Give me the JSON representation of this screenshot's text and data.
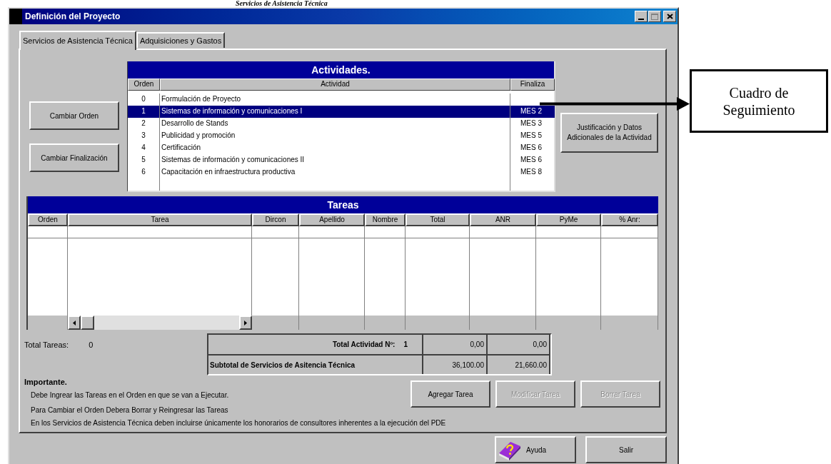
{
  "document_caption": "Servicios de Asistencia Técnica",
  "window": {
    "title": "Definición del Proyecto"
  },
  "tabs": [
    {
      "label": "Servicios de Asistencia Técnica",
      "selected": true
    },
    {
      "label": "Adquisiciones y Gastos",
      "selected": false
    }
  ],
  "side_buttons": [
    "Cambiar Orden",
    "Cambiar Finalización"
  ],
  "activities": {
    "title": "Actividades.",
    "columns": [
      "Orden",
      "Actividad",
      "Finaliza"
    ],
    "rows": [
      {
        "orden": "0",
        "actividad": "Formulación de Proyecto",
        "selected": false
      },
      {
        "orden": "1",
        "actividad": "Sistemas de información y comunicaciones I",
        "finaliza": "MES 2",
        "selected": true
      },
      {
        "orden": "2",
        "actividad": "Desarrollo de Stands",
        "finaliza": "MES 3",
        "selected": false
      },
      {
        "orden": "3",
        "actividad": "Publicidad y promoción",
        "finaliza": "MES 5",
        "selected": false
      },
      {
        "orden": "4",
        "actividad": "Certificación",
        "finaliza": "MES 6",
        "selected": false
      },
      {
        "orden": "5",
        "actividad": "Sistemas de información y comunicaciones II",
        "finaliza": "MES 6",
        "selected": false
      },
      {
        "orden": "6",
        "actividad": "Capacitación en infraestructura productiva",
        "finaliza": "MES 8",
        "selected": false
      }
    ]
  },
  "detail_button": "Justificación y Datos Adicionales de la Actividad",
  "tasks": {
    "title": "Tareas",
    "columns": [
      "Orden",
      "Tarea",
      "Dircon",
      "Apellido",
      "Nombre",
      "Total",
      "ANR",
      "PyMe",
      "% Anr:"
    ]
  },
  "total_tareas": {
    "label": "Total Tareas:",
    "value": "0"
  },
  "totals": [
    {
      "label": "Total Actividad Nº:",
      "number": "1",
      "total": "0,00",
      "anr": "0,00"
    },
    {
      "label": "Subtotal de Servicios de Asitencia Técnica",
      "total": "36,100.00",
      "anr": "21,660.00"
    }
  ],
  "notes": {
    "heading": "Importante.",
    "lines": [
      "Debe Ingrear las Tareas en el Orden en que se van a Ejecutar.",
      "Para Cambiar el Orden Debera Borrar y Reingresar las Tareas",
      "En los Servicios de Asistencia Técnica deben incluirse únicamente los honorarios de consultores inherentes a la ejecución del PDE"
    ]
  },
  "task_buttons": [
    {
      "label": "Agregar Tarea",
      "disabled": false
    },
    {
      "label": "Modificar Tarea",
      "disabled": true
    },
    {
      "label": "Borrar Tarea",
      "disabled": true
    }
  ],
  "bottom_buttons": [
    {
      "label": "Ayuda",
      "kind": "help"
    },
    {
      "label": "Salir",
      "kind": "plain"
    }
  ],
  "callout": {
    "text": "Cuadro de Seguimiento"
  }
}
